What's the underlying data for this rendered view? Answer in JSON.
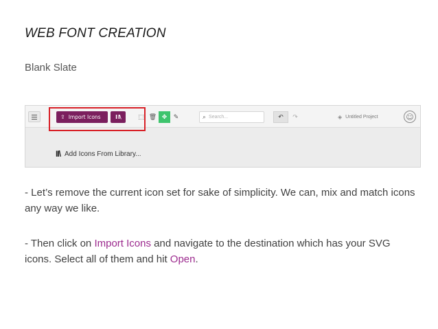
{
  "slide": {
    "title": "WEB FONT CREATION",
    "subtitle": "Blank Slate"
  },
  "app": {
    "toolbar": {
      "import_label": "Import Icons",
      "search_placeholder": "Search...",
      "project_name": "Untitled Project"
    },
    "add_library_label": "Add Icons From Library...",
    "colors": {
      "import_button": "#7b1f5e",
      "active_tool": "#3ec46d",
      "highlight": "#d81f26"
    }
  },
  "instructions": {
    "p1": "- Let’s remove the current icon set for sake of simplicity. We can, mix and match icons any way we like.",
    "p2_prefix": "- Then click on ",
    "p2_link1": "Import Icons",
    "p2_mid": " and navigate to the destination which has your SVG icons. Select all of them and hit ",
    "p2_link2": "Open",
    "p2_suffix": "."
  },
  "icons": [
    "menu-icon",
    "upload-icon",
    "library-icon",
    "select-icon",
    "trash-icon",
    "move-icon",
    "pencil-icon",
    "search-icon",
    "undo-icon",
    "redo-icon",
    "layers-icon",
    "smiley-icon"
  ]
}
